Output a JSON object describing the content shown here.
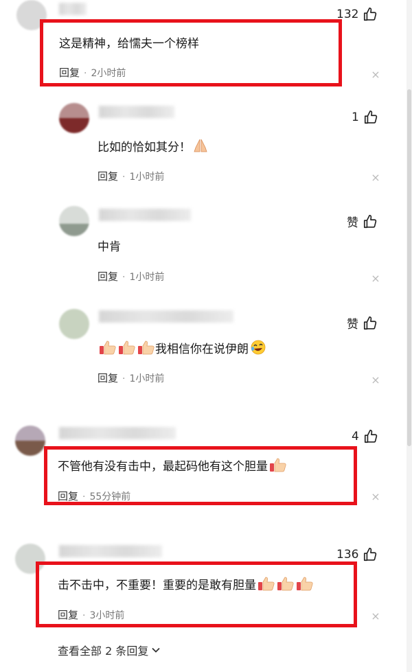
{
  "colors": {
    "highlight": "#e8121b",
    "meta_text": "#777777",
    "text": "#1a1a1a"
  },
  "comments": [
    {
      "text": "这是精神，给懦夫一个榜样",
      "reply": "回复",
      "time": "2小时前",
      "likes": "132",
      "close": "×",
      "emoji": []
    },
    {
      "text": "比如的恰如其分！",
      "reply": "回复",
      "time": "1小时前",
      "likes": "1",
      "close": "×",
      "emoji": [
        "praying-hands"
      ]
    },
    {
      "text": "中肯",
      "reply": "回复",
      "time": "1小时前",
      "likes": "赞",
      "close": "×",
      "emoji": []
    },
    {
      "text": "我相信你在说伊朗",
      "reply": "回复",
      "time": "1小时前",
      "likes": "赞",
      "close": "×",
      "emoji": [
        "thumbs-up",
        "thumbs-up",
        "thumbs-up",
        "rolling-laughing"
      ]
    },
    {
      "text": "不管他有没有击中，最起码他有这个胆量",
      "reply": "回复",
      "time": "55分钟前",
      "likes": "4",
      "close": "×",
      "emoji": [
        "thumbs-up"
      ]
    },
    {
      "text": "击不击中，不重要！重要的是敢有胆量",
      "reply": "回复",
      "time": "3小时前",
      "likes": "136",
      "close": "×",
      "emoji": [
        "thumbs-up",
        "thumbs-up",
        "thumbs-up"
      ]
    }
  ],
  "see_all": {
    "label": "查看全部 2 条回复"
  }
}
